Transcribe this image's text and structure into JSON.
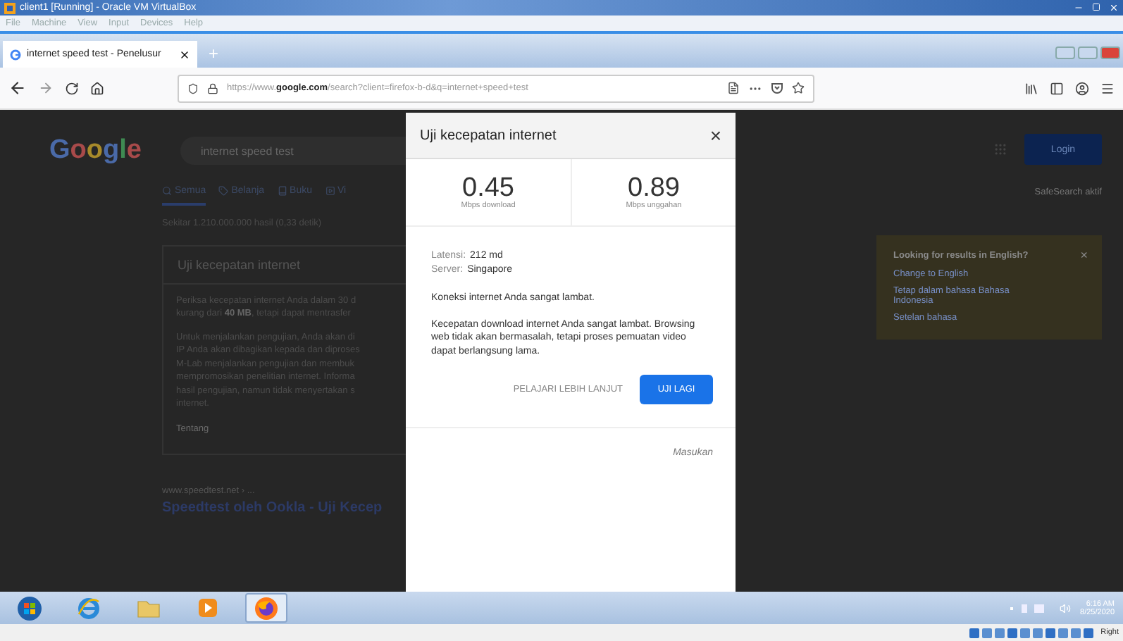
{
  "vm_window": {
    "title": "client1 [Running] - Oracle VM VirtualBox",
    "menu": [
      "File",
      "Machine",
      "View",
      "Input",
      "Devices",
      "Help"
    ]
  },
  "browser": {
    "tabs": [
      {
        "title": "internet speed test - Penelusur",
        "selected": true
      }
    ],
    "new_tab": "+",
    "url": "https://www.**google.com**/search?client=firefox-b-d&q=internet+speed+test"
  },
  "search_page": {
    "logo": "Google",
    "query": "internet speed test",
    "tabs": [
      {
        "label": "Semua",
        "kind": "search",
        "selected": true
      },
      {
        "label": "Belanja",
        "kind": "shop",
        "selected": false
      },
      {
        "label": "Buku",
        "kind": "book",
        "selected": false
      },
      {
        "label": "Vi",
        "kind": "video",
        "selected": false
      }
    ],
    "result_stats": "Sekitar 1.210.000.000 hasil (0,33 detik)",
    "card": {
      "title": "Uji kecepatan internet",
      "paragraphs": [
        "Periksa kecepatan internet Anda dalam 30 d\nkurang dari **40 MB**, tetapi dapat mentrasfer",
        "Untuk menjalankan pengujian, Anda akan di\nIP Anda akan dibagikan kepada dan diproses\nM-Lab menjalankan pengujian dan membuk\nmempromosikan penelitian internet. Informa\nhasil pengujian, namun tidak menyertakan s\ninternet."
      ],
      "link": "Tentang"
    },
    "result": {
      "breadcrumb": "www.speedtest.net › ...",
      "title": "Speedtest oleh Ookla - Uji Kecep"
    },
    "login": "Login",
    "safesearch": "SafeSearch aktif",
    "language_box": {
      "title": "Looking for results in English?",
      "close": "×",
      "links": [
        "Change to English",
        "Tetap dalam bahasa Bahasa Indonesia",
        "Setelan bahasa"
      ]
    }
  },
  "dialog": {
    "title": "Uji kecepatan internet",
    "close": "×",
    "stats": [
      {
        "value": "0.45",
        "label": "Mbps download"
      },
      {
        "value": "0.89",
        "label": "Mbps unggahan"
      }
    ],
    "details": [
      {
        "label": "Latensi:",
        "value": "212 md"
      },
      {
        "label": "Server:",
        "value": "Singapore"
      }
    ],
    "summary": "Koneksi internet Anda sangat lambat.",
    "explanation": "Kecepatan download internet Anda sangat lambat. Browsing web tidak akan bermasalah, tetapi proses pemuatan video dapat berlangsung lama.",
    "learn_more": "PELAJARI LEBIH LANJUT",
    "retry": "UJI LAGI",
    "feedback": "Masukan"
  },
  "taskbar": {
    "apps": [
      {
        "kind": "start",
        "selected": false
      },
      {
        "kind": "ie",
        "selected": false
      },
      {
        "kind": "folder",
        "selected": false
      },
      {
        "kind": "media",
        "selected": false
      },
      {
        "kind": "firefox",
        "selected": true
      }
    ],
    "time": "6:16 AM",
    "date": "8/25/2020"
  },
  "status_bar": {
    "host_key": "Right"
  }
}
